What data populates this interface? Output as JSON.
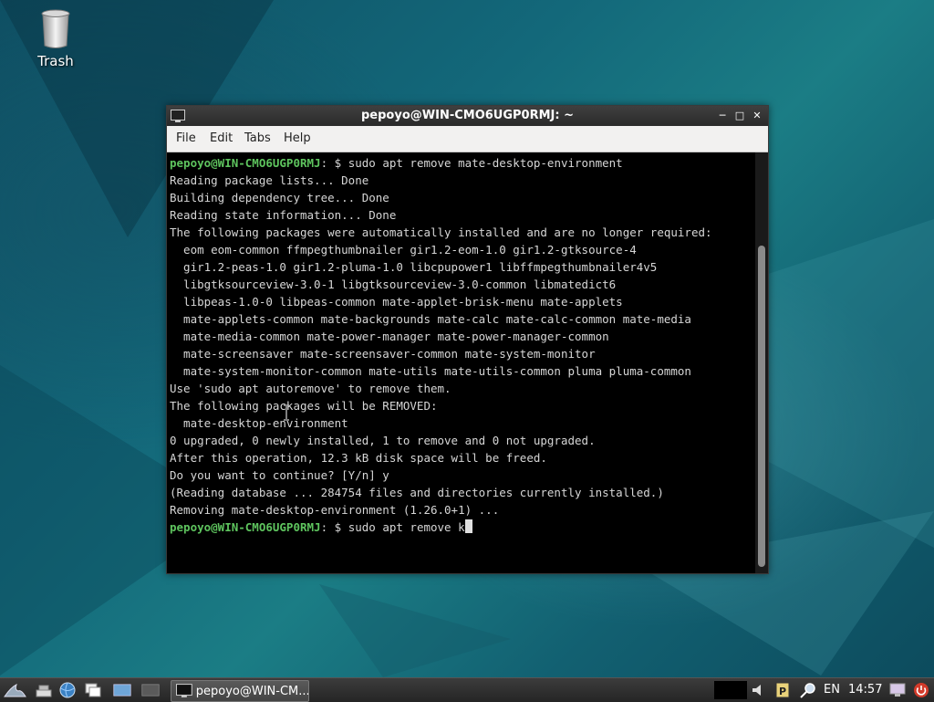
{
  "desktop": {
    "icons": [
      {
        "label": "Trash",
        "icon": "trash-icon"
      }
    ]
  },
  "window": {
    "title": "pepoyo@WIN-CMO6UGP0RMJ: ~",
    "menu": [
      "File",
      "Edit",
      "Tabs",
      "Help"
    ]
  },
  "terminal": {
    "prompt": "pepoyo@WIN-CMO6UGP0RMJ",
    "prompt_suffix": ": $ ",
    "lines": [
      {
        "prompt": true,
        "text": "sudo apt remove mate-desktop-environment"
      },
      {
        "prompt": false,
        "text": "Reading package lists... Done"
      },
      {
        "prompt": false,
        "text": "Building dependency tree... Done"
      },
      {
        "prompt": false,
        "text": "Reading state information... Done"
      },
      {
        "prompt": false,
        "text": "The following packages were automatically installed and are no longer required:"
      },
      {
        "prompt": false,
        "text": "  eom eom-common ffmpegthumbnailer gir1.2-eom-1.0 gir1.2-gtksource-4"
      },
      {
        "prompt": false,
        "text": "  gir1.2-peas-1.0 gir1.2-pluma-1.0 libcpupower1 libffmpegthumbnailer4v5"
      },
      {
        "prompt": false,
        "text": "  libgtksourceview-3.0-1 libgtksourceview-3.0-common libmatedict6"
      },
      {
        "prompt": false,
        "text": "  libpeas-1.0-0 libpeas-common mate-applet-brisk-menu mate-applets"
      },
      {
        "prompt": false,
        "text": "  mate-applets-common mate-backgrounds mate-calc mate-calc-common mate-media"
      },
      {
        "prompt": false,
        "text": "  mate-media-common mate-power-manager mate-power-manager-common"
      },
      {
        "prompt": false,
        "text": "  mate-screensaver mate-screensaver-common mate-system-monitor"
      },
      {
        "prompt": false,
        "text": "  mate-system-monitor-common mate-utils mate-utils-common pluma pluma-common"
      },
      {
        "prompt": false,
        "text": "Use 'sudo apt autoremove' to remove them."
      },
      {
        "prompt": false,
        "text": "The following packages will be REMOVED:"
      },
      {
        "prompt": false,
        "text": "  mate-desktop-environment"
      },
      {
        "prompt": false,
        "text": "0 upgraded, 0 newly installed, 1 to remove and 0 not upgraded."
      },
      {
        "prompt": false,
        "text": "After this operation, 12.3 kB disk space will be freed."
      },
      {
        "prompt": false,
        "text": "Do you want to continue? [Y/n] y"
      },
      {
        "prompt": false,
        "text": "(Reading database ... 284754 files and directories currently installed.)"
      },
      {
        "prompt": false,
        "text": "Removing mate-desktop-environment (1.26.0+1) ..."
      },
      {
        "prompt": true,
        "text": "sudo apt remove k",
        "cursor": true
      }
    ]
  },
  "taskbar": {
    "task_label": "pepoyo@WIN-CM...",
    "language": "EN",
    "clock": "14:57"
  }
}
